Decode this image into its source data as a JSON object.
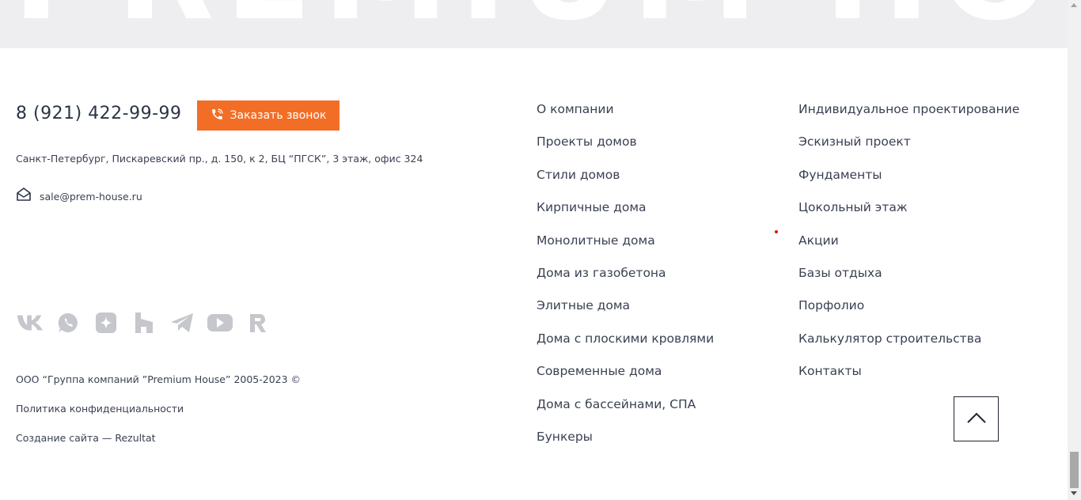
{
  "banner": {
    "text": "PREMIUM HOUSE"
  },
  "contacts": {
    "phone": "8 (921) 422-99-99",
    "callback_label": "Заказать звонок",
    "address": "Санкт-Петербург, Пискаревский пр., д. 150, к 2, БЦ “ПГСК”, 3 этаж, офис 324",
    "email": "sale@prem-house.ru"
  },
  "socials": [
    {
      "name": "vk-icon"
    },
    {
      "name": "whatsapp-icon"
    },
    {
      "name": "zen-icon"
    },
    {
      "name": "houzz-icon"
    },
    {
      "name": "telegram-icon"
    },
    {
      "name": "youtube-icon"
    },
    {
      "name": "rutube-icon"
    }
  ],
  "footer": {
    "copyright": "ООО “Группа компаний ”Premium House” 2005-2023 ©",
    "privacy": "Политика конфиденциальности",
    "creator_prefix": "Создание сайта — ",
    "creator_link": "Rezultat"
  },
  "menu": {
    "col1": [
      "О компании",
      "Проекты домов",
      "Стили домов",
      "Кирпичные дома",
      "Монолитные дома",
      "Дома из газобетона",
      "Элитные дома",
      "Дома с плоскими кровлями",
      "Современные дома",
      "Дома с бассейнами, СПА",
      "Бункеры"
    ],
    "col2": [
      "Индивидуальное проектирование",
      "Эскизный проект",
      "Фундаменты",
      "Цокольный этаж",
      "Акции",
      "Базы отдыха",
      "Порфолио",
      "Калькулятор строительства",
      "Контакты"
    ]
  },
  "colors": {
    "accent": "#f26e27",
    "text": "#2b3447",
    "icon_gray": "#c5c7cc",
    "banner_bg": "#eeeef0"
  }
}
